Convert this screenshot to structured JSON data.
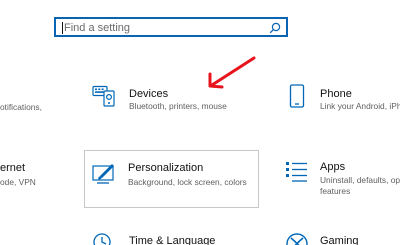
{
  "search": {
    "placeholder": "Find a setting"
  },
  "tiles": [
    {
      "title": "",
      "description": "otifications,",
      "icon": "system-icon"
    },
    {
      "title": "Devices",
      "description": "Bluetooth, printers, mouse",
      "icon": "keyboard-printer-icon"
    },
    {
      "title": "Phone",
      "description": "Link your Android, iPh",
      "icon": "phone-icon"
    },
    {
      "title": "ernet",
      "description": "ode, VPN",
      "icon": "network-icon"
    },
    {
      "title": "Personalization",
      "description": "Background, lock screen, colors",
      "icon": "paintbrush-screen-icon"
    },
    {
      "title": "Apps",
      "description_line1": "Uninstall, defaults, op",
      "description_line2": "features",
      "icon": "apps-list-icon"
    },
    {
      "title": "Time & Language",
      "icon": "clock-language-icon"
    },
    {
      "title": "Gaming",
      "icon": "xbox-icon"
    }
  ],
  "annotation": {
    "color": "#e8141b",
    "icon": "red-arrow"
  },
  "colors": {
    "accent": "#0a64b4",
    "icon_blue": "#0067b8"
  }
}
